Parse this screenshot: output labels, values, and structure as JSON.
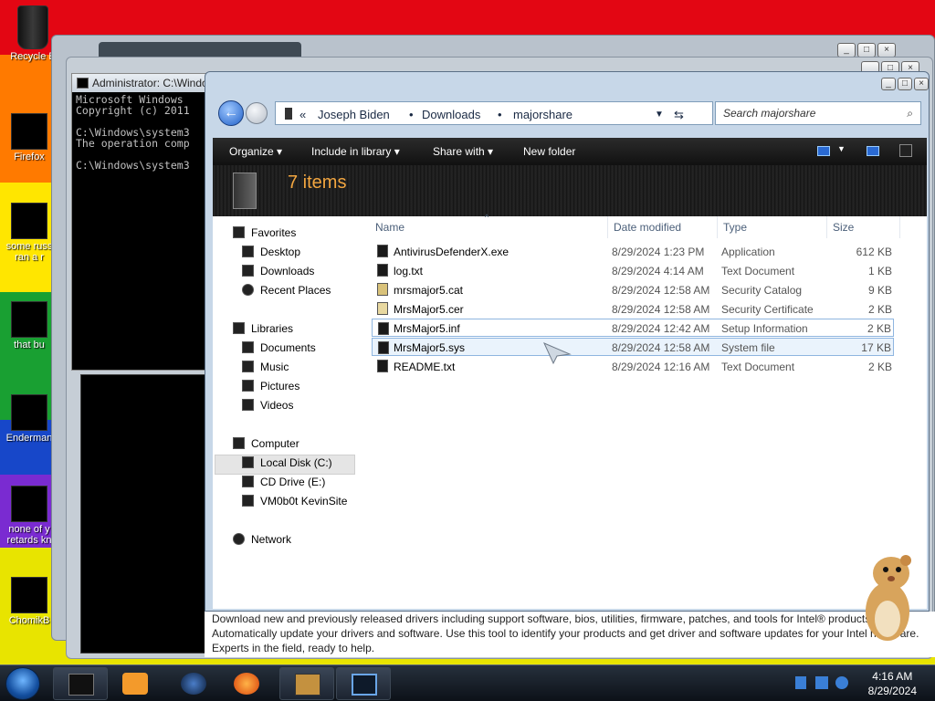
{
  "desktop": {
    "icons": [
      {
        "label": "Recycle B",
        "icon": "recycle-bin-icon"
      },
      {
        "label": "Firefox",
        "icon": "firefox-icon"
      },
      {
        "label": "some russ\nran a r",
        "icon": "blacked-out-icon"
      },
      {
        "label": "that bu",
        "icon": "blacked-out-icon"
      },
      {
        "label": "Enderman",
        "icon": "blacked-out-icon"
      },
      {
        "label": "none of y\nretards kn",
        "icon": "blacked-out-icon"
      },
      {
        "label": "ChomikB",
        "icon": "hamster-icon"
      }
    ]
  },
  "cmd": {
    "title": "Administrator: C:\\Windo",
    "lines": "Microsoft Windows\nCopyright (c) 2011\n\nC:\\Windows\\system3\nThe operation comp\n\nC:\\Windows\\system3"
  },
  "explorer": {
    "nav": {
      "back": "back-arrow-icon",
      "forward": "forward-arrow-icon"
    },
    "breadcrumb": [
      "Joseph Biden",
      "Downloads",
      "majorshare"
    ],
    "search_placeholder": "Search majorshare",
    "toolbar": {
      "organize": "Organize",
      "include": "Include in library",
      "share": "Share with",
      "new_folder": "New folder"
    },
    "items_count": "7 items",
    "sidebar": {
      "favorites": "Favorites",
      "desktop": "Desktop",
      "downloads": "Downloads",
      "recent": "Recent Places",
      "libraries": "Libraries",
      "documents": "Documents",
      "music": "Music",
      "pictures": "Pictures",
      "videos": "Videos",
      "computer": "Computer",
      "local_disk": "Local Disk (C:)",
      "cd_drive": "CD Drive (E:)",
      "vm": "VM0b0t KevinSite",
      "network": "Network"
    },
    "columns": {
      "name": "Name",
      "date": "Date modified",
      "type": "Type",
      "size": "Size"
    },
    "files": [
      {
        "name": "AntivirusDefenderX.exe",
        "date": "8/29/2024 1:23 PM",
        "type": "Application",
        "size": "612 KB"
      },
      {
        "name": "log.txt",
        "date": "8/29/2024 4:14 AM",
        "type": "Text Document",
        "size": "1 KB"
      },
      {
        "name": "mrsmajor5.cat",
        "date": "8/29/2024 12:58 AM",
        "type": "Security Catalog",
        "size": "9 KB"
      },
      {
        "name": "MrsMajor5.cer",
        "date": "8/29/2024 12:58 AM",
        "type": "Security Certificate",
        "size": "2 KB"
      },
      {
        "name": "MrsMajor5.inf",
        "date": "8/29/2024 12:42 AM",
        "type": "Setup Information",
        "size": "2 KB"
      },
      {
        "name": "MrsMajor5.sys",
        "date": "8/29/2024 12:58 AM",
        "type": "System file",
        "size": "17 KB"
      },
      {
        "name": "README.txt",
        "date": "8/29/2024 12:16 AM",
        "type": "Text Document",
        "size": "2 KB"
      }
    ]
  },
  "web_text": "Download new and previously released drivers including support software, bios, utilities, firmware, patches, and tools for Intel® products. Automatically update your drivers and software. Use this tool to identify your products and get driver and software updates for your Intel hardware. Experts in the field, ready to help.",
  "taskbar": {
    "time": "4:16 AM",
    "date": "8/29/2024"
  }
}
